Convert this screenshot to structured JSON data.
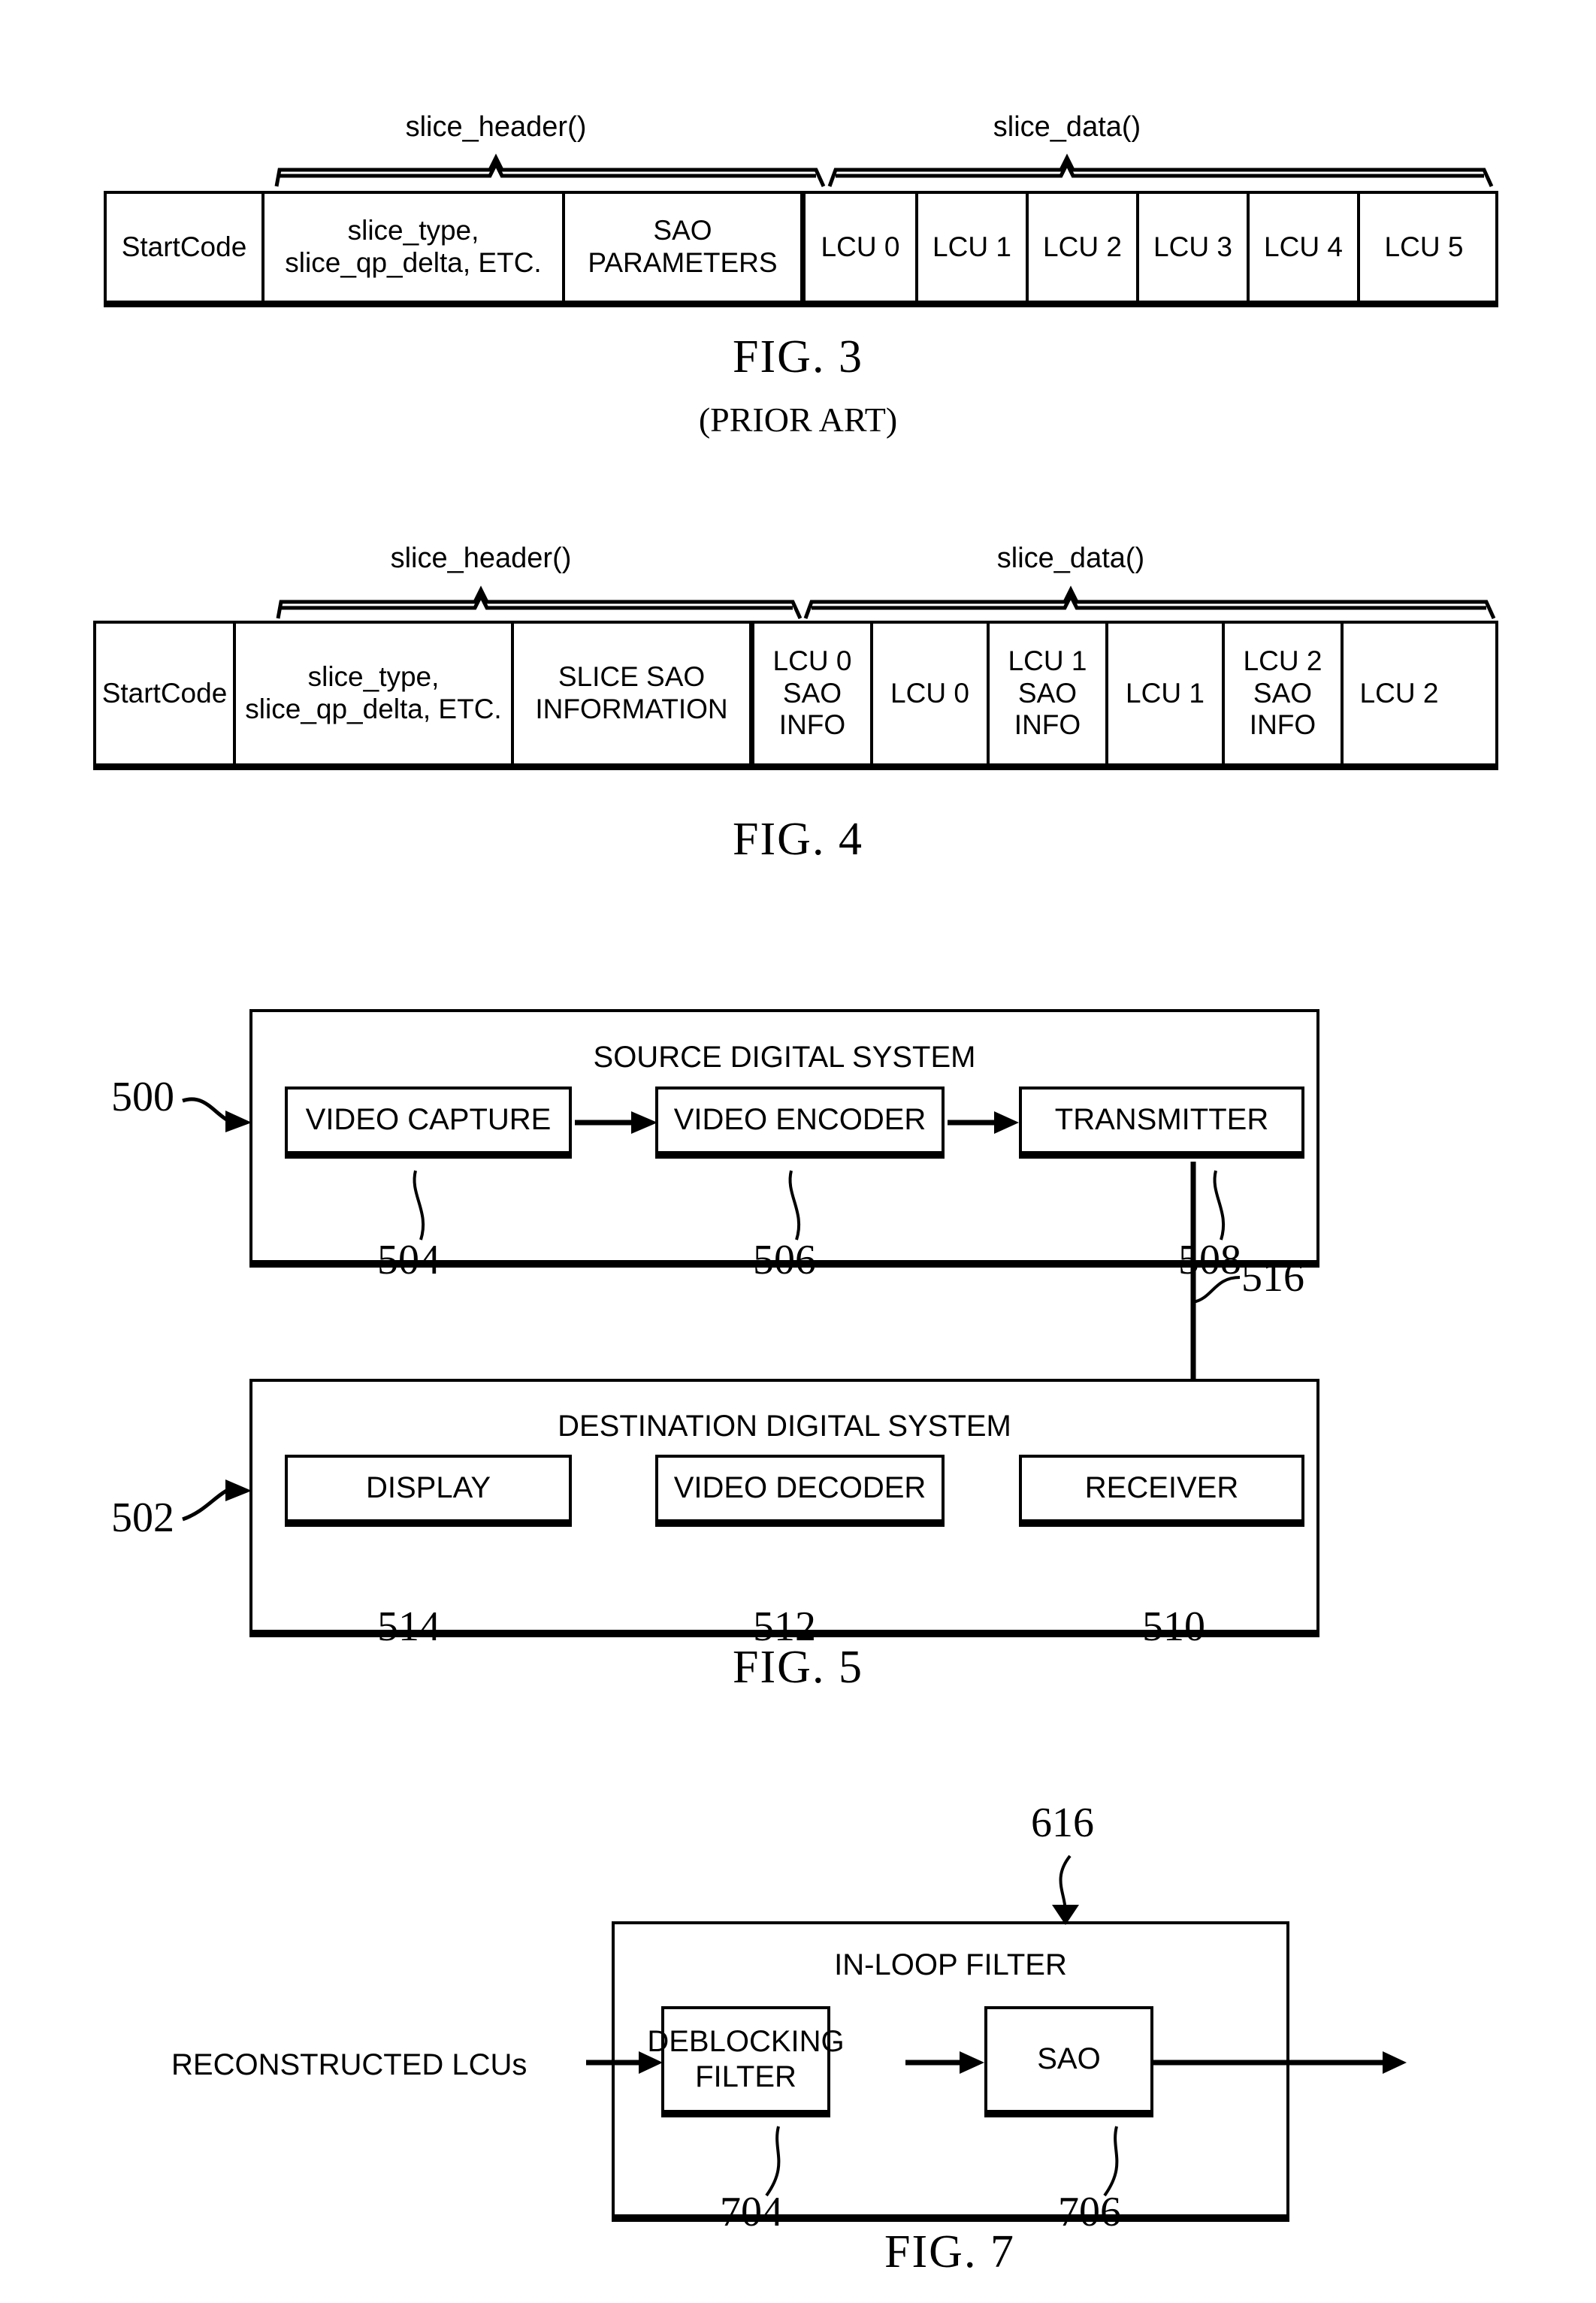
{
  "figures": [
    {
      "id": "fig3",
      "caption": "FIG. 3",
      "subcaption": "(PRIOR ART)",
      "brace_labels": {
        "header": "slice_header()",
        "data": "slice_data()"
      },
      "cells": [
        {
          "text": "StartCode"
        },
        {
          "text": "slice_type,\nslice_qp_delta, ETC."
        },
        {
          "text": "SAO\nPARAMETERS"
        },
        {
          "text": "LCU 0"
        },
        {
          "text": "LCU 1"
        },
        {
          "text": "LCU 2"
        },
        {
          "text": "LCU 3"
        },
        {
          "text": "LCU 4"
        },
        {
          "text": "LCU 5"
        }
      ]
    },
    {
      "id": "fig4",
      "caption": "FIG. 4",
      "subcaption": "",
      "brace_labels": {
        "header": "slice_header()",
        "data": "slice_data()"
      },
      "cells": [
        {
          "text": "StartCode"
        },
        {
          "text": "slice_type,\nslice_qp_delta, ETC."
        },
        {
          "text": "SLICE SAO\nINFORMATION"
        },
        {
          "text": "LCU 0\nSAO\nINFO"
        },
        {
          "text": "LCU 0"
        },
        {
          "text": "LCU 1\nSAO\nINFO"
        },
        {
          "text": "LCU 1"
        },
        {
          "text": "LCU 2\nSAO\nINFO"
        },
        {
          "text": "LCU 2"
        }
      ]
    }
  ],
  "fig5": {
    "caption": "FIG. 5",
    "source_system": {
      "title": "SOURCE DIGITAL SYSTEM",
      "ref": "500",
      "units": [
        {
          "label": "VIDEO CAPTURE",
          "ref": "504"
        },
        {
          "label": "VIDEO ENCODER",
          "ref": "506"
        },
        {
          "label": "TRANSMITTER",
          "ref": "508"
        }
      ]
    },
    "channel_ref": "516",
    "destination_system": {
      "title": "DESTINATION DIGITAL SYSTEM",
      "ref": "502",
      "units": [
        {
          "label": "DISPLAY",
          "ref": "514"
        },
        {
          "label": "VIDEO DECODER",
          "ref": "512"
        },
        {
          "label": "RECEIVER",
          "ref": "510"
        }
      ]
    }
  },
  "fig7": {
    "caption": "FIG. 7",
    "title": "IN-LOOP FILTER",
    "ref": "616",
    "input_label": "RECONSTRUCTED LCUs",
    "units": [
      {
        "label": "DEBLOCKING\nFILTER",
        "ref": "704"
      },
      {
        "label": "SAO",
        "ref": "706"
      }
    ]
  },
  "colors": {
    "ink": "#000000",
    "paper": "#ffffff"
  }
}
